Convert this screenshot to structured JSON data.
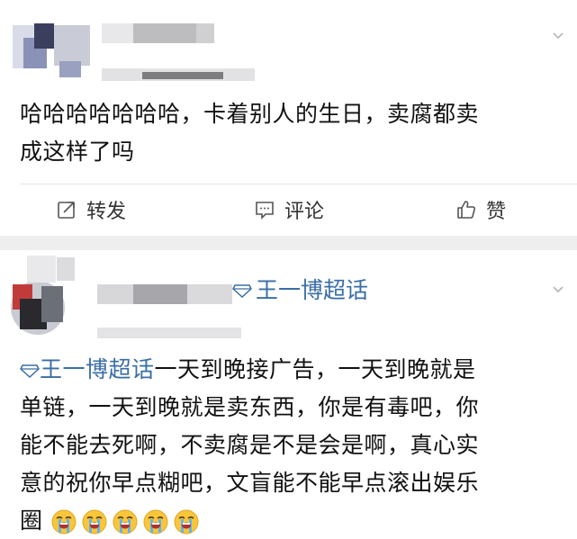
{
  "post1": {
    "text_line1": "哈哈哈哈哈哈哈，卡着别人的生日，卖腐都卖",
    "text_line2": "成这样了吗",
    "actions": {
      "repost_label": "转发",
      "comment_label": "评论",
      "like_label": "赞"
    }
  },
  "post2": {
    "topic_tag": "王一博超话",
    "text_lines": [
      "一天到晚接广告，一天到晚就是",
      "单链，一天到晚就是卖东西，你是有毒吧，你",
      "能不能去死啊，不卖腐是不是会是啊，真心实",
      "意的祝你早点糊吧，文盲能不能早点滚出娱乐",
      "圈"
    ],
    "inline_topic": "王一博超话",
    "emoji_count": 5
  },
  "colors": {
    "topic_blue": "#3a6ea5",
    "separator_gray": "#eeeeee"
  },
  "icons": [
    "chevron-down-icon",
    "repost-icon",
    "comment-icon",
    "like-icon",
    "super-topic-diamond-icon",
    "crying-emoji-icon"
  ]
}
